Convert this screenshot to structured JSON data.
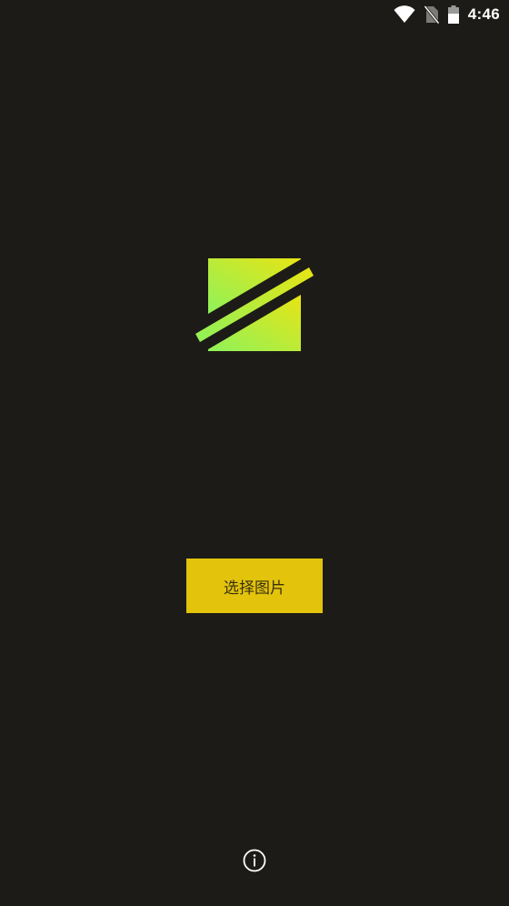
{
  "status_bar": {
    "time": "4:46",
    "icons": [
      "wifi-icon",
      "no-sim-icon",
      "battery-icon"
    ]
  },
  "logo": {
    "icon": "app-logo",
    "gradient_start": "#8ff25a",
    "gradient_end": "#e8e414"
  },
  "main": {
    "pick_image_label": "选择图片"
  },
  "footer": {
    "icon": "info-icon"
  },
  "colors": {
    "background": "#1d1b17",
    "accent": "#e3c30c"
  }
}
